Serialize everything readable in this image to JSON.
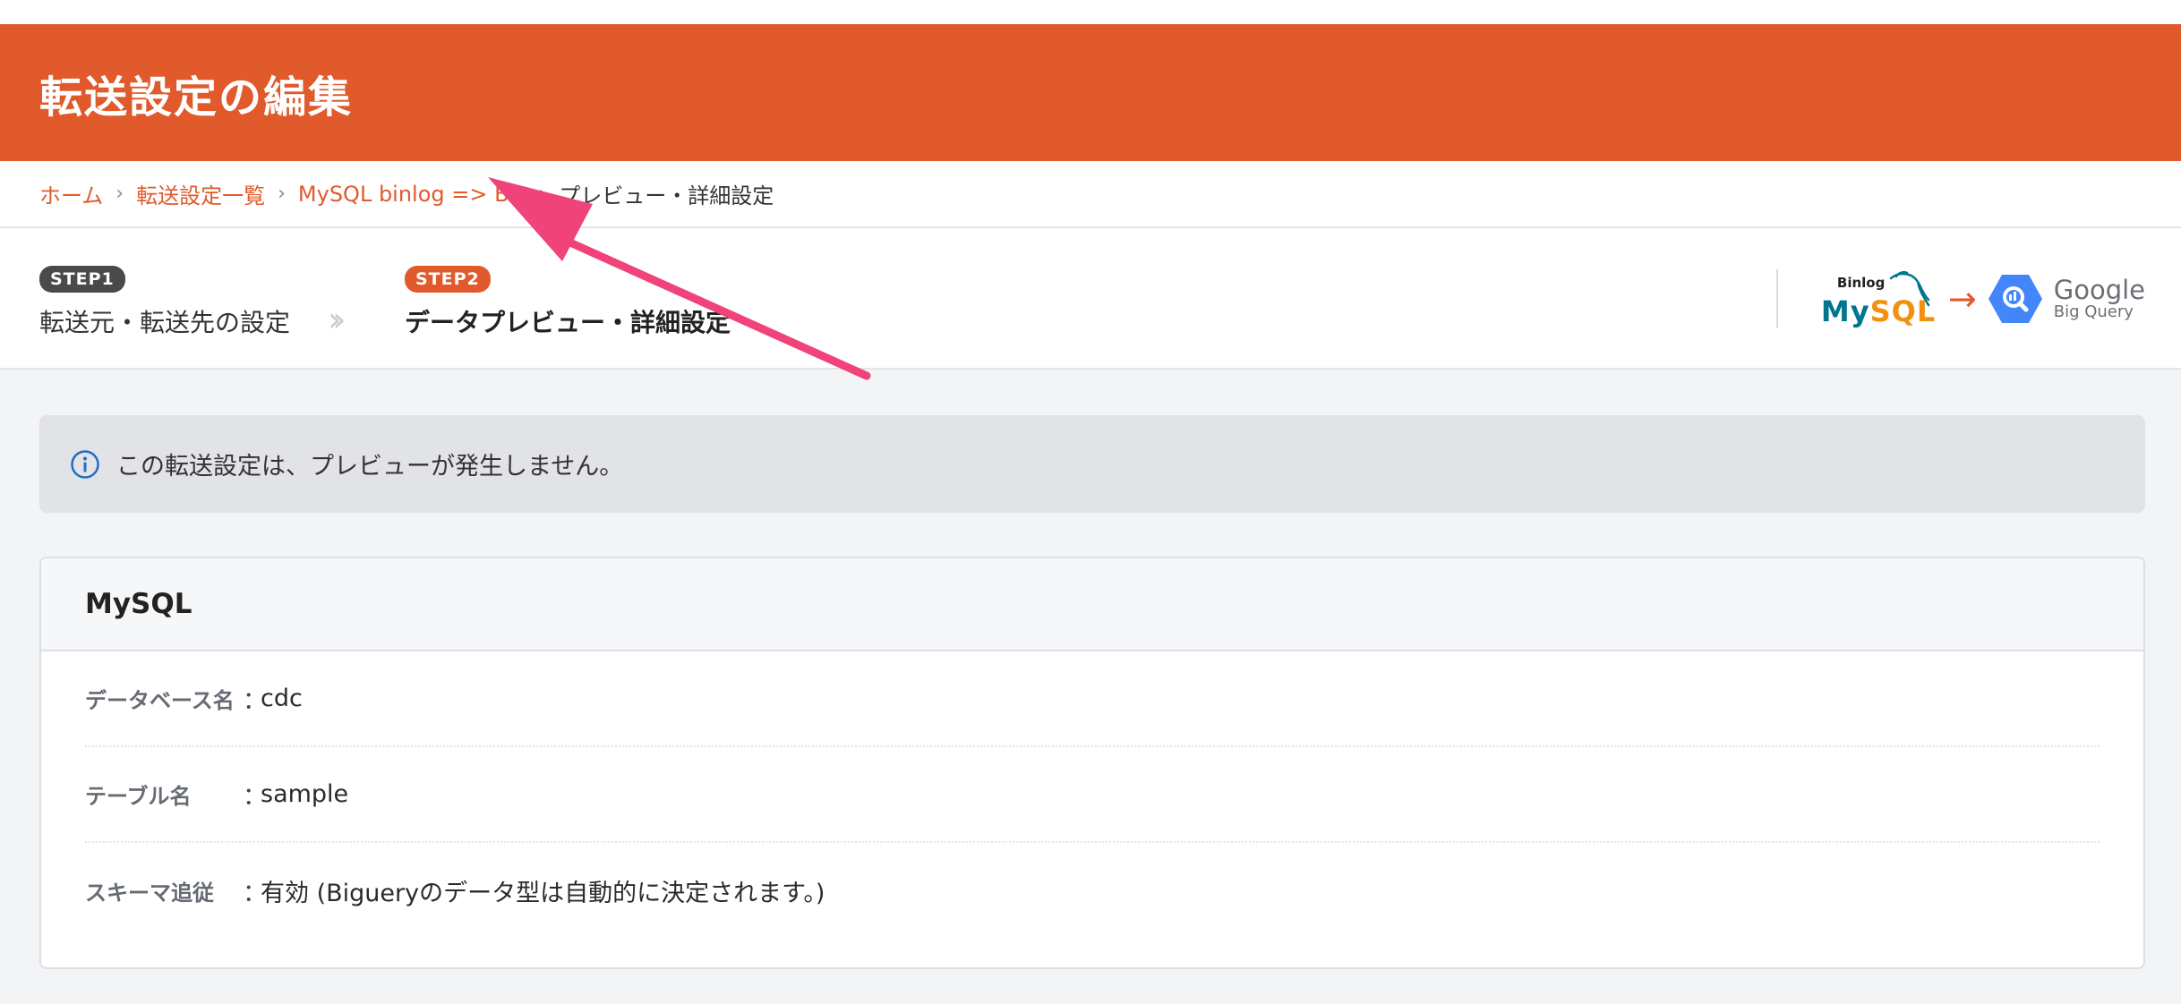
{
  "header": {
    "title": "転送設定の編集"
  },
  "breadcrumb": {
    "items": [
      {
        "label": "ホーム"
      },
      {
        "label": "転送設定一覧"
      },
      {
        "label": "MySQL binlog => BQ"
      }
    ],
    "current": "プレビュー・詳細設定",
    "separator": "›"
  },
  "steps": {
    "step1": {
      "badge": "STEP1",
      "label": "転送元・転送先の設定"
    },
    "step2": {
      "badge": "STEP2",
      "label": "データプレビュー・詳細設定"
    },
    "chevron": "››"
  },
  "logos": {
    "source_top": "Binlog",
    "source_my": "My",
    "source_sql": "SQL",
    "arrow": "→",
    "dest_main": "Google",
    "dest_sub": "Big Query"
  },
  "info": {
    "message": "この転送設定は、プレビューが発生しません。"
  },
  "card": {
    "title": "MySQL",
    "rows": [
      {
        "key": "データベース名",
        "colon": "：",
        "value": "cdc"
      },
      {
        "key": "テーブル名",
        "colon": "：",
        "value": "sample"
      },
      {
        "key": "スキーマ追従",
        "colon": "：",
        "value": "有効 (Bigueryのデータ型は自動的に決定されます。)"
      }
    ]
  },
  "colors": {
    "brand": "#e05a2c",
    "annotation_arrow": "#f0437a",
    "info_icon": "#1f6fc4"
  }
}
